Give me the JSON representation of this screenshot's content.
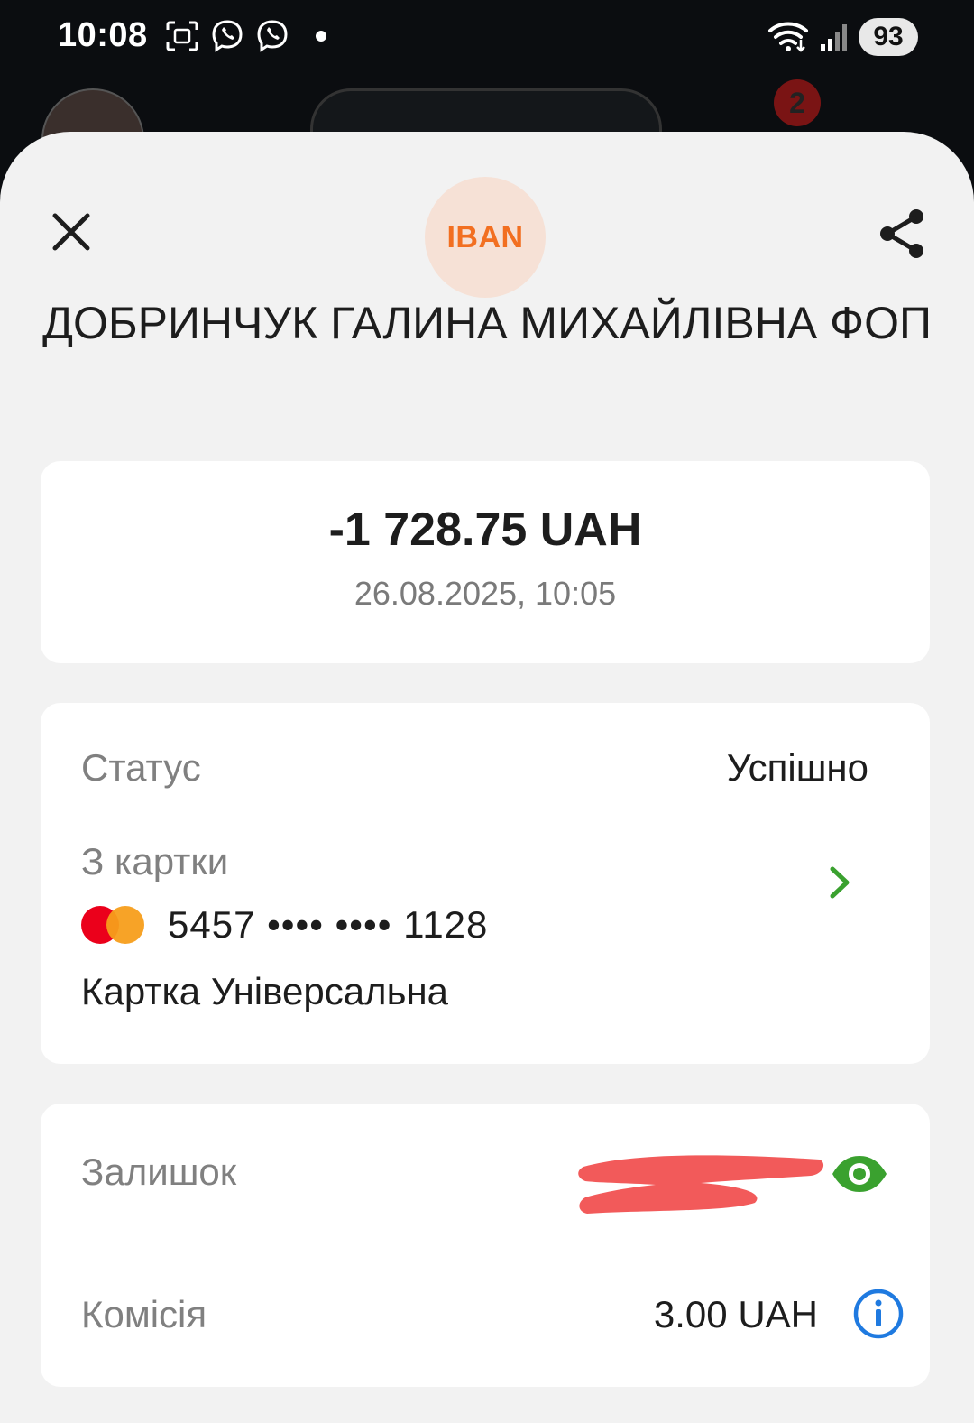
{
  "status_bar": {
    "time": "10:08",
    "battery": "93"
  },
  "background": {
    "notification_count": "2"
  },
  "header": {
    "badge_text": "IBAN",
    "recipient_name": "ДОБРИНЧУК ГАЛИНА МИХАЙЛІВНА ФОП"
  },
  "transaction": {
    "amount": "-1 728.75 UAH",
    "datetime": "26.08.2025, 10:05"
  },
  "details": {
    "status_label": "Статус",
    "status_value": "Успішно",
    "from_label": "З картки",
    "card_number": "5457 •••• •••• 1128",
    "card_name": "Картка Універсальна"
  },
  "balance": {
    "balance_label": "Залишок",
    "fee_label": "Комісія",
    "fee_value": "3.00 UAH"
  },
  "colors": {
    "accent_green": "#3aa12f",
    "info_blue": "#1f7ae0",
    "iban_orange": "#f26f21",
    "redaction": "#f25a5a"
  },
  "icons": [
    "close-icon",
    "share-icon",
    "chevron-right-icon",
    "eye-icon",
    "info-icon",
    "mastercard-icon"
  ]
}
